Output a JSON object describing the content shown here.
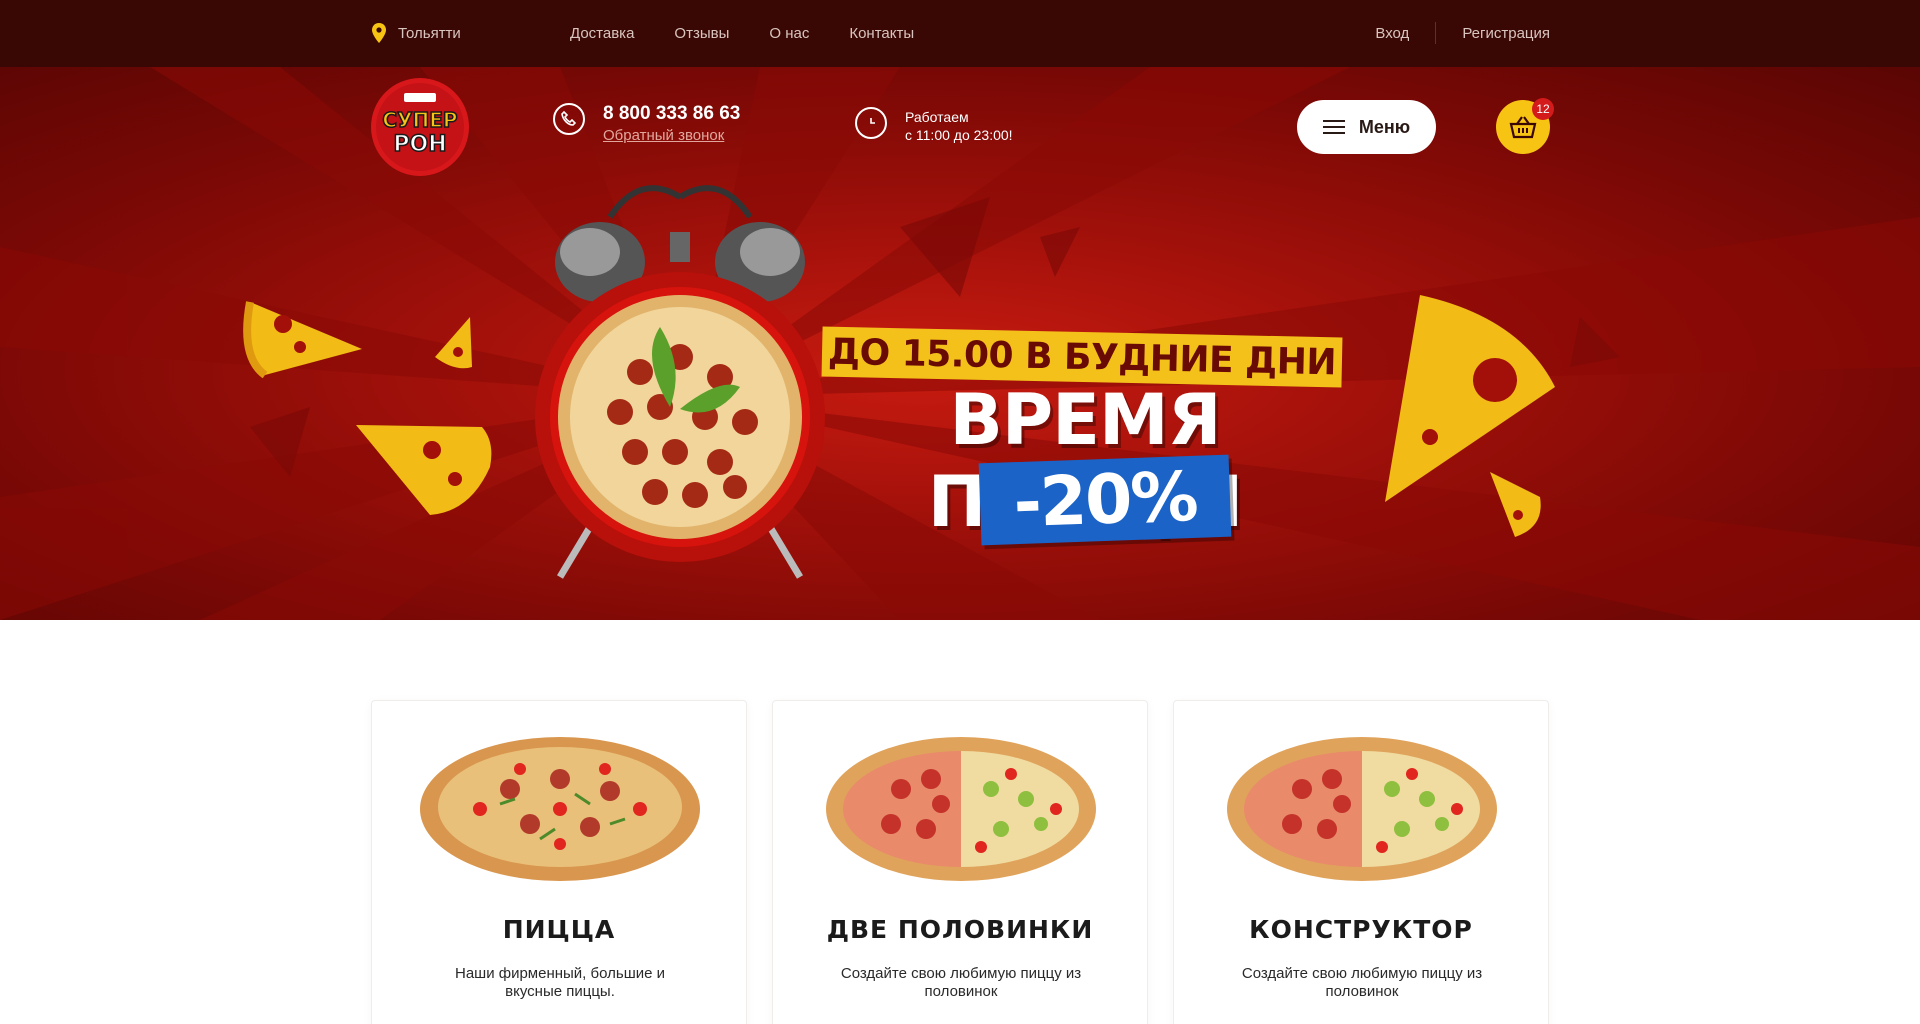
{
  "topbar": {
    "city": "Тольятти",
    "nav": [
      "Доставка",
      "Отзывы",
      "О нас",
      "Контакты"
    ],
    "login": "Вход",
    "register": "Регистрация"
  },
  "header": {
    "logo_text": "СУПЕР РОН",
    "phone": "8 800 333 86 63",
    "callback": "Обратный звонок",
    "hours_line1": "Работаем",
    "hours_line2": "с 11:00 до 23:00!",
    "menu_label": "Меню",
    "cart_count": "12"
  },
  "promo": {
    "line1": "ДО 15.00 В БУДНИЕ ДНИ",
    "line2": "ВРЕМЯ ПИЦЦЫ",
    "discount": "-20%"
  },
  "cards": [
    {
      "title": "ПИЦЦА",
      "desc": "Наши фирменный, большие и вкусные пиццы."
    },
    {
      "title": "ДВЕ ПОЛОВИНКИ",
      "desc": "Создайте свою любимую пиццу из половинок"
    },
    {
      "title": "КОНСТРУКТОР",
      "desc": "Создайте свою любимую пиццу из половинок"
    }
  ],
  "colors": {
    "accent": "#f8c414",
    "topbar": "#3a0804",
    "hero": "#a0100a",
    "promo_blue": "#1b63c6"
  }
}
